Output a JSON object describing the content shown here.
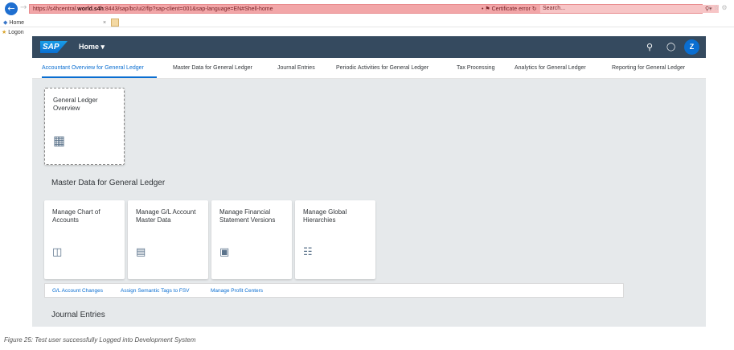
{
  "browser": {
    "url_prefix": "https://s4hcentral.",
    "url_host": "world.s4h",
    "url_rest": ":8443/sap/bc/ui2/flp?sap-client=001&sap-language=EN#Shell-home",
    "certificate_error": "Certificate error",
    "search_placeholder": "Search...",
    "tab_title": "Home",
    "favorite_label": "Logon"
  },
  "shell": {
    "logo_text": "SAP",
    "home_label": "Home ▾",
    "avatar_initial": "Z"
  },
  "anchor_tabs": [
    {
      "label": "Accountant Overview for General Ledger",
      "active": true
    },
    {
      "label": "Master Data for General Ledger",
      "active": false
    },
    {
      "label": "Journal Entries",
      "active": false
    },
    {
      "label": "Periodic Activities for General Ledger",
      "active": false
    },
    {
      "label": "Tax Processing",
      "active": false
    },
    {
      "label": "Analytics for General Ledger",
      "active": false
    },
    {
      "label": "Reporting for General Ledger",
      "active": false
    }
  ],
  "overview_tile": {
    "title": "General Ledger Overview",
    "icon": "overview-grid-icon"
  },
  "master_data_section": {
    "title": "Master Data for General Ledger",
    "tiles": [
      {
        "title": "Manage Chart of Accounts",
        "icon": "chart-of-accounts-icon"
      },
      {
        "title": "Manage G/L Account Master Data",
        "icon": "account-master-icon"
      },
      {
        "title": "Manage Financial Statement Versions",
        "icon": "financial-statement-icon"
      },
      {
        "title": "Manage Global Hierarchies",
        "icon": "hierarchy-icon"
      }
    ],
    "links": [
      "G/L Account Changes",
      "Assign Semantic Tags to FSV",
      "Manage Profit Centers"
    ]
  },
  "journal_section": {
    "title": "Journal Entries"
  },
  "caption": "Figure 25: Test user successfully Logged into Development System",
  "colors": {
    "shell_bar": "#354a5f",
    "accent": "#0a6ed1",
    "content_bg": "#e6e9eb",
    "url_error_bg": "#f2a6a8"
  }
}
